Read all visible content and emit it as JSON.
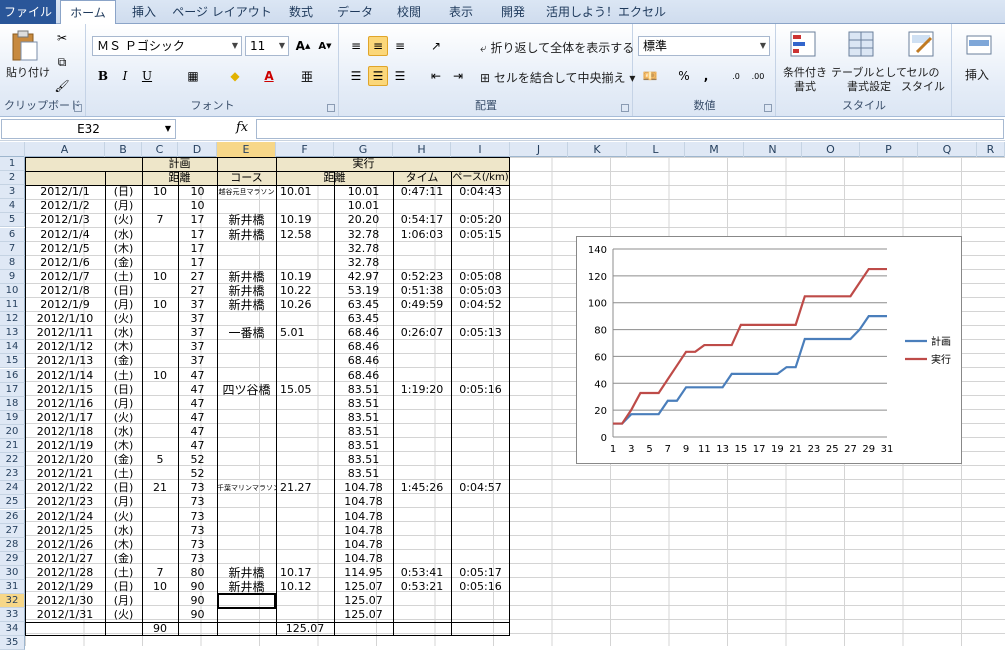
{
  "tabs": [
    "ファイル",
    "ホーム",
    "挿入",
    "ページ レイアウト",
    "数式",
    "データ",
    "校閲",
    "表示",
    "開発",
    "活用しよう！エクセル"
  ],
  "ribbon": {
    "clipboard": {
      "paste": "貼り付け",
      "label": "クリップボード"
    },
    "font": {
      "name": "ＭＳ Ｐゴシック",
      "size": "11",
      "label": "フォント",
      "bold": "B",
      "italic": "I",
      "underline": "U"
    },
    "align": {
      "wrap": "折り返して全体を表示する",
      "merge": "セルを結合して中央揃え",
      "label": "配置"
    },
    "number": {
      "format": "標準",
      "label": "数値",
      "percent": "%",
      "comma": ","
    },
    "styles": {
      "cond": "条件付き\n書式",
      "table": "テーブルとして\n書式設定",
      "cell": "セルの\nスタイル",
      "label": "スタイル"
    },
    "insert": {
      "label": "挿入"
    }
  },
  "formula": {
    "namebox": "E32",
    "fx": "fx"
  },
  "columns": [
    "A",
    "B",
    "C",
    "D",
    "E",
    "F",
    "G",
    "H",
    "I",
    "J",
    "K",
    "L",
    "M",
    "N",
    "O",
    "P",
    "Q",
    "R"
  ],
  "headers": {
    "keikaku": "計画",
    "jikko": "実行",
    "kyori1": "距離",
    "course": "コース",
    "kyori2": "距離",
    "time": "タイム",
    "pace": "ペース(/km)"
  },
  "rows": [
    {
      "n": "3",
      "date": "2012/1/1",
      "dow": "(日)",
      "c": "10",
      "d": "10",
      "e": "越谷元旦マラソン",
      "f": "10.01",
      "g": "10.01",
      "h": "0:47:11",
      "i": "0:04:43"
    },
    {
      "n": "4",
      "date": "2012/1/2",
      "dow": "(月)",
      "c": "",
      "d": "10",
      "e": "",
      "f": "",
      "g": "10.01",
      "h": "",
      "i": ""
    },
    {
      "n": "5",
      "date": "2012/1/3",
      "dow": "(火)",
      "c": "7",
      "d": "17",
      "e": "新井橋",
      "f": "10.19",
      "g": "20.20",
      "h": "0:54:17",
      "i": "0:05:20"
    },
    {
      "n": "6",
      "date": "2012/1/4",
      "dow": "(水)",
      "c": "",
      "d": "17",
      "e": "新井橋",
      "f": "12.58",
      "g": "32.78",
      "h": "1:06:03",
      "i": "0:05:15"
    },
    {
      "n": "7",
      "date": "2012/1/5",
      "dow": "(木)",
      "c": "",
      "d": "17",
      "e": "",
      "f": "",
      "g": "32.78",
      "h": "",
      "i": ""
    },
    {
      "n": "8",
      "date": "2012/1/6",
      "dow": "(金)",
      "c": "",
      "d": "17",
      "e": "",
      "f": "",
      "g": "32.78",
      "h": "",
      "i": ""
    },
    {
      "n": "9",
      "date": "2012/1/7",
      "dow": "(土)",
      "c": "10",
      "d": "27",
      "e": "新井橋",
      "f": "10.19",
      "g": "42.97",
      "h": "0:52:23",
      "i": "0:05:08"
    },
    {
      "n": "10",
      "date": "2012/1/8",
      "dow": "(日)",
      "c": "",
      "d": "27",
      "e": "新井橋",
      "f": "10.22",
      "g": "53.19",
      "h": "0:51:38",
      "i": "0:05:03"
    },
    {
      "n": "11",
      "date": "2012/1/9",
      "dow": "(月)",
      "c": "10",
      "d": "37",
      "e": "新井橋",
      "f": "10.26",
      "g": "63.45",
      "h": "0:49:59",
      "i": "0:04:52"
    },
    {
      "n": "12",
      "date": "2012/1/10",
      "dow": "(火)",
      "c": "",
      "d": "37",
      "e": "",
      "f": "",
      "g": "63.45",
      "h": "",
      "i": ""
    },
    {
      "n": "13",
      "date": "2012/1/11",
      "dow": "(水)",
      "c": "",
      "d": "37",
      "e": "一番橋",
      "f": "5.01",
      "g": "68.46",
      "h": "0:26:07",
      "i": "0:05:13"
    },
    {
      "n": "14",
      "date": "2012/1/12",
      "dow": "(木)",
      "c": "",
      "d": "37",
      "e": "",
      "f": "",
      "g": "68.46",
      "h": "",
      "i": ""
    },
    {
      "n": "15",
      "date": "2012/1/13",
      "dow": "(金)",
      "c": "",
      "d": "37",
      "e": "",
      "f": "",
      "g": "68.46",
      "h": "",
      "i": ""
    },
    {
      "n": "16",
      "date": "2012/1/14",
      "dow": "(土)",
      "c": "10",
      "d": "47",
      "e": "",
      "f": "",
      "g": "68.46",
      "h": "",
      "i": ""
    },
    {
      "n": "17",
      "date": "2012/1/15",
      "dow": "(日)",
      "c": "",
      "d": "47",
      "e": "四ツ谷橋",
      "f": "15.05",
      "g": "83.51",
      "h": "1:19:20",
      "i": "0:05:16"
    },
    {
      "n": "18",
      "date": "2012/1/16",
      "dow": "(月)",
      "c": "",
      "d": "47",
      "e": "",
      "f": "",
      "g": "83.51",
      "h": "",
      "i": ""
    },
    {
      "n": "19",
      "date": "2012/1/17",
      "dow": "(火)",
      "c": "",
      "d": "47",
      "e": "",
      "f": "",
      "g": "83.51",
      "h": "",
      "i": ""
    },
    {
      "n": "20",
      "date": "2012/1/18",
      "dow": "(水)",
      "c": "",
      "d": "47",
      "e": "",
      "f": "",
      "g": "83.51",
      "h": "",
      "i": ""
    },
    {
      "n": "21",
      "date": "2012/1/19",
      "dow": "(木)",
      "c": "",
      "d": "47",
      "e": "",
      "f": "",
      "g": "83.51",
      "h": "",
      "i": ""
    },
    {
      "n": "22",
      "date": "2012/1/20",
      "dow": "(金)",
      "c": "5",
      "d": "52",
      "e": "",
      "f": "",
      "g": "83.51",
      "h": "",
      "i": ""
    },
    {
      "n": "23",
      "date": "2012/1/21",
      "dow": "(土)",
      "c": "",
      "d": "52",
      "e": "",
      "f": "",
      "g": "83.51",
      "h": "",
      "i": ""
    },
    {
      "n": "24",
      "date": "2012/1/22",
      "dow": "(日)",
      "c": "21",
      "d": "73",
      "e": "千葉マリンマラソン",
      "f": "21.27",
      "g": "104.78",
      "h": "1:45:26",
      "i": "0:04:57"
    },
    {
      "n": "25",
      "date": "2012/1/23",
      "dow": "(月)",
      "c": "",
      "d": "73",
      "e": "",
      "f": "",
      "g": "104.78",
      "h": "",
      "i": ""
    },
    {
      "n": "26",
      "date": "2012/1/24",
      "dow": "(火)",
      "c": "",
      "d": "73",
      "e": "",
      "f": "",
      "g": "104.78",
      "h": "",
      "i": ""
    },
    {
      "n": "27",
      "date": "2012/1/25",
      "dow": "(水)",
      "c": "",
      "d": "73",
      "e": "",
      "f": "",
      "g": "104.78",
      "h": "",
      "i": ""
    },
    {
      "n": "28",
      "date": "2012/1/26",
      "dow": "(木)",
      "c": "",
      "d": "73",
      "e": "",
      "f": "",
      "g": "104.78",
      "h": "",
      "i": ""
    },
    {
      "n": "29",
      "date": "2012/1/27",
      "dow": "(金)",
      "c": "",
      "d": "73",
      "e": "",
      "f": "",
      "g": "104.78",
      "h": "",
      "i": ""
    },
    {
      "n": "30",
      "date": "2012/1/28",
      "dow": "(土)",
      "c": "7",
      "d": "80",
      "e": "新井橋",
      "f": "10.17",
      "g": "114.95",
      "h": "0:53:41",
      "i": "0:05:17"
    },
    {
      "n": "31",
      "date": "2012/1/29",
      "dow": "(日)",
      "c": "10",
      "d": "90",
      "e": "新井橋",
      "f": "10.12",
      "g": "125.07",
      "h": "0:53:21",
      "i": "0:05:16"
    },
    {
      "n": "32",
      "date": "2012/1/30",
      "dow": "(月)",
      "c": "",
      "d": "90",
      "e": "",
      "f": "",
      "g": "125.07",
      "h": "",
      "i": ""
    },
    {
      "n": "33",
      "date": "2012/1/31",
      "dow": "(火)",
      "c": "",
      "d": "90",
      "e": "",
      "f": "",
      "g": "125.07",
      "h": "",
      "i": ""
    }
  ],
  "totals": {
    "c": "90",
    "f": "125.07"
  },
  "extra_rows": [
    "34",
    "35"
  ],
  "chart_data": {
    "type": "line",
    "x": [
      1,
      2,
      3,
      4,
      5,
      6,
      7,
      8,
      9,
      10,
      11,
      12,
      13,
      14,
      15,
      16,
      17,
      18,
      19,
      20,
      21,
      22,
      23,
      24,
      25,
      26,
      27,
      28,
      29,
      30,
      31
    ],
    "xticks": [
      "1",
      "3",
      "5",
      "7",
      "9",
      "11",
      "13",
      "15",
      "17",
      "19",
      "21",
      "23",
      "25",
      "27",
      "29",
      "31"
    ],
    "ylim": [
      0,
      140
    ],
    "yticks": [
      "0",
      "20",
      "40",
      "60",
      "80",
      "100",
      "120",
      "140"
    ],
    "grid": true,
    "legend": "right",
    "series": [
      {
        "name": "計画",
        "color": "#4a7ebb",
        "values": [
          10,
          10,
          17,
          17,
          17,
          17,
          27,
          27,
          37,
          37,
          37,
          37,
          37,
          47,
          47,
          47,
          47,
          47,
          47,
          52,
          52,
          73,
          73,
          73,
          73,
          73,
          73,
          80,
          90,
          90,
          90
        ]
      },
      {
        "name": "実行",
        "color": "#be4b48",
        "values": [
          10.01,
          10.01,
          20.2,
          32.78,
          32.78,
          32.78,
          42.97,
          53.19,
          63.45,
          63.45,
          68.46,
          68.46,
          68.46,
          68.46,
          83.51,
          83.51,
          83.51,
          83.51,
          83.51,
          83.51,
          83.51,
          104.78,
          104.78,
          104.78,
          104.78,
          104.78,
          104.78,
          114.95,
          125.07,
          125.07,
          125.07
        ]
      }
    ]
  }
}
